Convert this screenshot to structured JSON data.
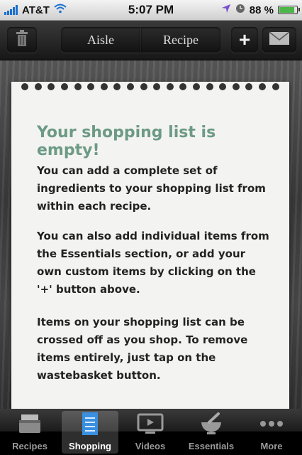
{
  "status_bar": {
    "carrier": "AT&T",
    "time": "5:07 PM",
    "battery": "88 %",
    "battery_level": 0.88,
    "icons": [
      "signal-icon",
      "wifi-icon",
      "location-icon",
      "alarm-icon",
      "battery-icon"
    ]
  },
  "toolbar": {
    "trash_icon": "trash-icon",
    "aisle_label": "Aisle",
    "recipe_label": "Recipe",
    "add_label": "+",
    "mail_icon": "envelope-icon"
  },
  "content": {
    "title": "Your shopping list is empty!",
    "paragraph1": "You can add a complete set of ingredients to your shopping list from within each recipe.",
    "paragraph2": "You can also add individual items from the Essentials section, or add your own custom items by clicking on the '+' button above.",
    "paragraph3": "Items on your shopping list can be crossed off as you shop. To remove items entirely, just tap on the wastebasket button."
  },
  "tabs": [
    {
      "label": "Recipes",
      "icon": "recipe-box-icon",
      "active": false
    },
    {
      "label": "Shopping",
      "icon": "shopping-list-icon",
      "active": true
    },
    {
      "label": "Videos",
      "icon": "video-icon",
      "active": false
    },
    {
      "label": "Essentials",
      "icon": "mortar-pestle-icon",
      "active": false
    },
    {
      "label": "More",
      "icon": "more-dots-icon",
      "active": false
    }
  ],
  "colors": {
    "title": "#6c9a85",
    "active_tab_icon": "#3b8fe0"
  }
}
